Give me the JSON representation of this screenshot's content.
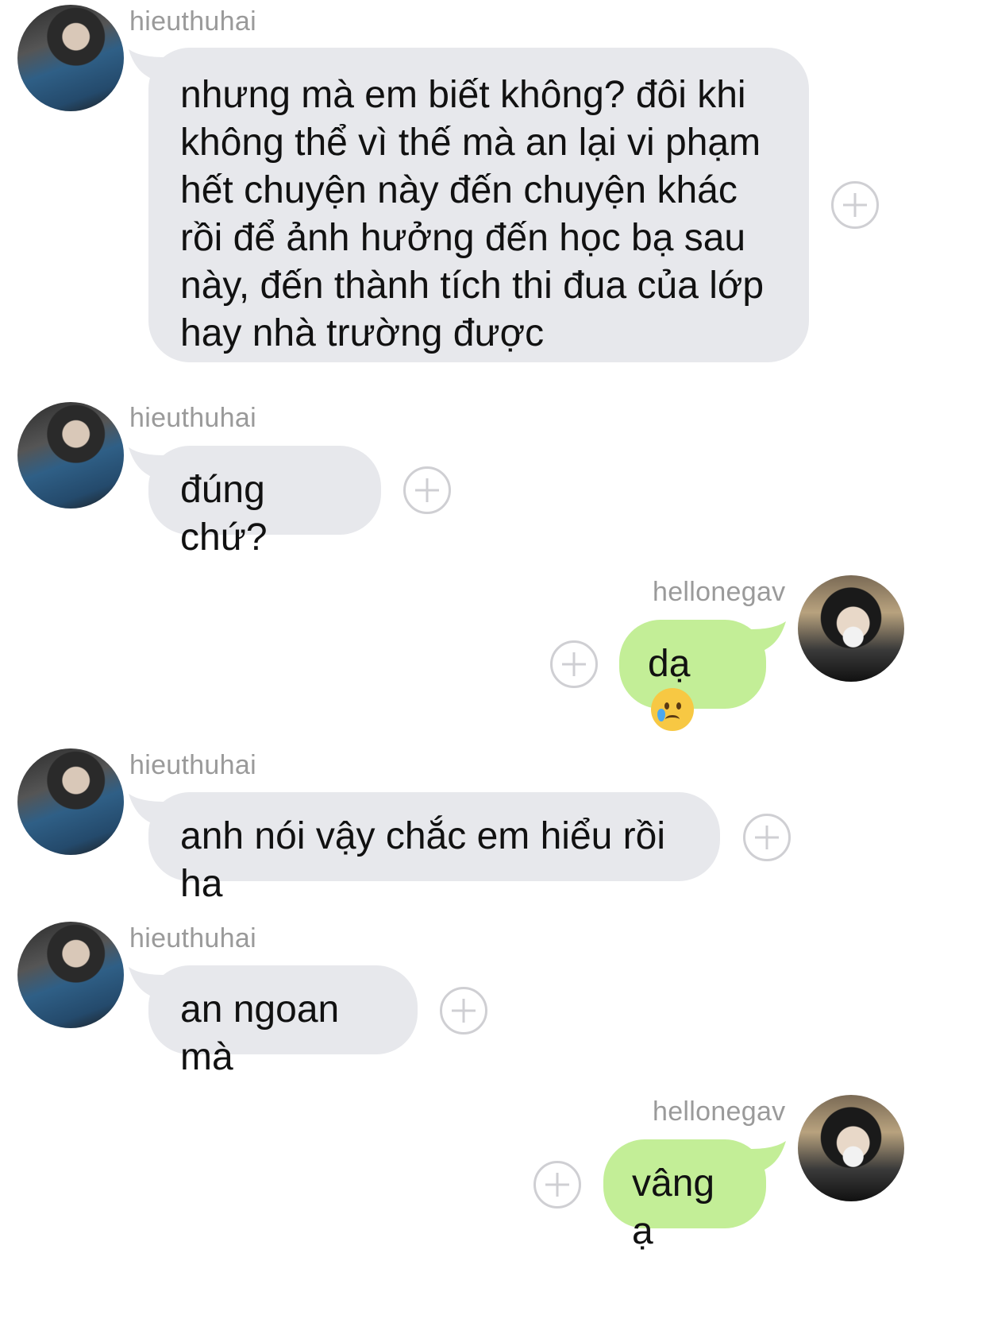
{
  "conversation": {
    "messages": [
      {
        "sender": "hieuthuhai",
        "direction": "incoming",
        "text": "nhưng mà em biết không? đôi khi không thể vì thế mà an lại vi phạm hết chuyện này đến chuyện khác rồi để ảnh hưởng đến học bạ sau này, đến thành tích thi đua của lớp hay nhà trường được"
      },
      {
        "sender": "hieuthuhai",
        "direction": "incoming",
        "text": "đúng chứ?"
      },
      {
        "sender": "hellonegav",
        "direction": "outgoing",
        "text": "dạ",
        "emoji": "crying-face-emoji"
      },
      {
        "sender": "hieuthuhai",
        "direction": "incoming",
        "text": "anh nói vậy chắc em hiểu rồi ha"
      },
      {
        "sender": "hieuthuhai",
        "direction": "incoming",
        "text": "an ngoan mà"
      },
      {
        "sender": "hellonegav",
        "direction": "outgoing",
        "text": "vâng ạ"
      }
    ]
  },
  "colors": {
    "incoming_bubble": "#e7e8ec",
    "outgoing_bubble": "#c3ee97",
    "sender_name": "#9a9a9a",
    "plus_icon": "#cfcfd3"
  },
  "icons": {
    "react_button": "plus-circle-icon"
  }
}
